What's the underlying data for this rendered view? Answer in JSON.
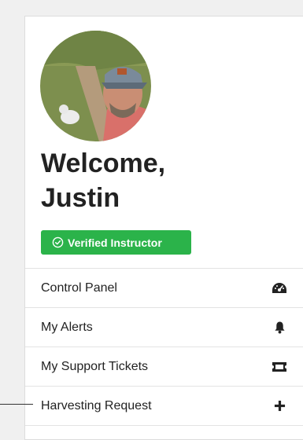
{
  "profile": {
    "welcome_line1": "Welcome,",
    "welcome_line2": "Justin",
    "badge_label": "Verified Instructor",
    "badge_icon": "check-circle-icon"
  },
  "menu": {
    "items": [
      {
        "label": "Control Panel",
        "icon": "speedometer-icon"
      },
      {
        "label": "My Alerts",
        "icon": "bell-icon"
      },
      {
        "label": "My Support Tickets",
        "icon": "ticket-icon"
      },
      {
        "label": "Harvesting Request",
        "icon": "plus-icon"
      }
    ]
  },
  "colors": {
    "badge": "#2bb34a",
    "text": "#222222",
    "divider": "#e3e3e3"
  }
}
